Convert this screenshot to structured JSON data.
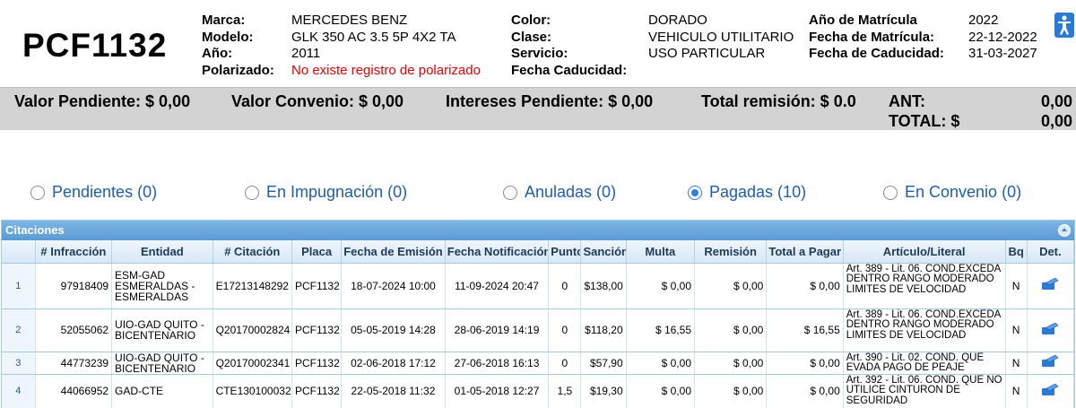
{
  "header": {
    "plate": "PCF1132",
    "col1": [
      {
        "label": "Marca:",
        "value": "MERCEDES BENZ"
      },
      {
        "label": "Modelo:",
        "value": "GLK 350 AC 3.5 5P 4X2 TA"
      },
      {
        "label": "Año:",
        "value": "2011"
      },
      {
        "label": "Polarizado:",
        "value": "No existe registro de polarizado"
      }
    ],
    "col2": [
      {
        "label": "Color:",
        "value": "DORADO"
      },
      {
        "label": "Clase:",
        "value": "VEHICULO UTILITARIO"
      },
      {
        "label": "Servicio:",
        "value": "USO PARTICULAR"
      },
      {
        "label": "Fecha Caducidad:",
        "value": ""
      }
    ],
    "col3": [
      {
        "label": "Año de Matrícula",
        "value": "2022"
      },
      {
        "label": "Fecha de Matrícula:",
        "value": "22-12-2022"
      },
      {
        "label": "Fecha de Caducidad:",
        "value": "31-03-2027"
      }
    ],
    "corner_icon": "accessibility-icon"
  },
  "summary": {
    "valor_pendiente": "Valor Pendiente: $ 0,00",
    "valor_convenio": "Valor Convenio: $ 0,00",
    "intereses_pendiente": "Intereses Pendiente: $ 0,00",
    "total_remision": "Total remisión: $ 0.0",
    "ant_label": "ANT:",
    "ant_value": "0,00",
    "total_label": "TOTAL: $",
    "total_value": "0,00"
  },
  "filters": [
    {
      "label": "Pendientes (0)",
      "selected": false
    },
    {
      "label": "En Impugnación (0)",
      "selected": false
    },
    {
      "label": "Anuladas (0)",
      "selected": false
    },
    {
      "label": "Pagadas (10)",
      "selected": true
    },
    {
      "label": "En Convenio (0)",
      "selected": false
    }
  ],
  "grid": {
    "title": "Citaciones",
    "columns": [
      "",
      "# Infracción",
      "Entidad",
      "# Citación",
      "Placa",
      "Fecha de Emisión",
      "Fecha Notificación",
      "Puntos",
      "Sanción",
      "Multa",
      "Remisión",
      "Total a Pagar",
      "Artículo/Literal",
      "Bq",
      "Det."
    ],
    "rows": [
      {
        "n": "1",
        "infraccion": "97918409",
        "entidad": "ESM-GAD ESMERALDAS - ESMERALDAS",
        "citacion": "E17213148292",
        "placa": "PCF1132",
        "emision": "18-07-2024 10:00",
        "notificacion": "11-09-2024 20:47",
        "puntos": "0",
        "sancion": "$138,00",
        "multa": "$ 0,00",
        "remision": "$ 0,00",
        "total": "$ 0,00",
        "articulo": "Art. 389 - Lit. 06. COND.EXCEDA DENTRO RANGO MODERADO LIMITES DE VELOCIDAD",
        "bq": "N"
      },
      {
        "n": "2",
        "infraccion": "52055062",
        "entidad": "UIO-GAD QUITO - BICENTENARIO",
        "citacion": "Q20170002824",
        "placa": "PCF1132",
        "emision": "05-05-2019 14:28",
        "notificacion": "28-06-2019 14:19",
        "puntos": "0",
        "sancion": "$118,20",
        "multa": "$ 16,55",
        "remision": "$ 0,00",
        "total": "$ 16,55",
        "articulo": "Art. 389 - Lit. 06. COND.EXCEDA DENTRO RANGO MODERADO LIMITES DE VELOCIDAD",
        "bq": "N"
      },
      {
        "n": "3",
        "infraccion": "44773239",
        "entidad": "UIO-GAD QUITO - BICENTENARIO",
        "citacion": "Q20170002341",
        "placa": "PCF1132",
        "emision": "02-06-2018 17:12",
        "notificacion": "27-06-2018 16:13",
        "puntos": "0",
        "sancion": "$57,90",
        "multa": "$ 0,00",
        "remision": "$ 0,00",
        "total": "$ 0,00",
        "articulo": "Art. 390 - Lit. 02. COND. QUE EVADA PAGO DE PEAJE",
        "bq": "N"
      },
      {
        "n": "4",
        "infraccion": "44066952",
        "entidad": "GAD-CTE",
        "citacion": "CTE130100032",
        "placa": "PCF1132",
        "emision": "22-05-2018 11:32",
        "notificacion": "01-05-2018 12:27",
        "puntos": "1,5",
        "sancion": "$19,30",
        "multa": "$ 0,00",
        "remision": "$ 0,00",
        "total": "$ 0,00",
        "articulo": "Art. 392 - Lit. 06. COND. QUE NO UTILICE CINTURON DE SEGURIDAD",
        "bq": "N"
      }
    ]
  }
}
